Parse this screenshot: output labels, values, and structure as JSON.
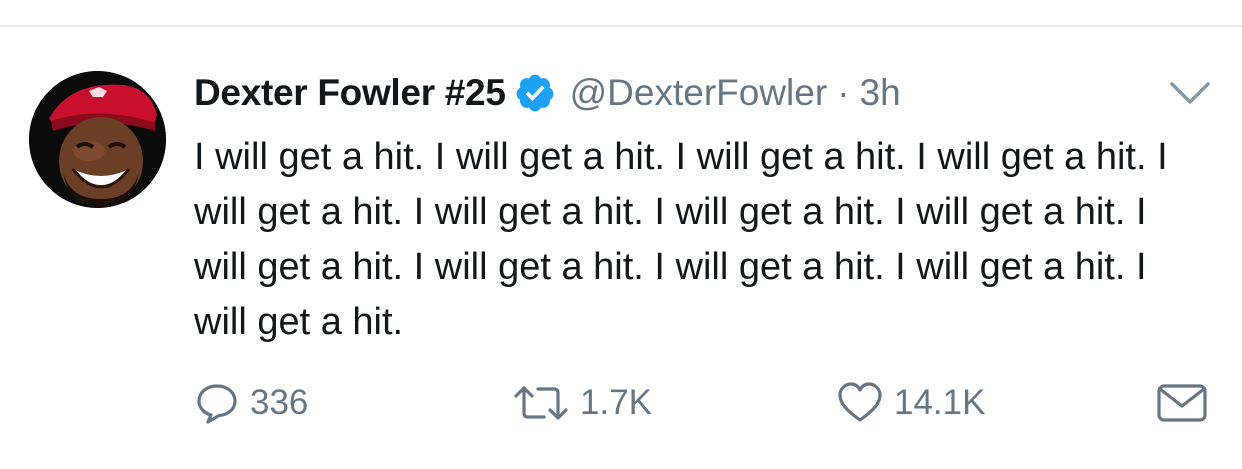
{
  "tweet": {
    "display_name": "Dexter Fowler #25",
    "handle": "@DexterFowler",
    "separator": "·",
    "time": "3h",
    "verified": true,
    "text": "I will get a hit. I will get a hit. I will get a hit. I will get a hit. I will get a hit. I will get a hit. I will get a hit. I will get a hit. I will get a hit. I will get a hit. I will get a hit. I will get a hit. I will get a hit."
  },
  "actions": {
    "reply_count": "336",
    "retweet_count": "1.7K",
    "like_count": "14.1K"
  },
  "icons": {
    "verified": "verified-badge-icon",
    "menu": "chevron-down-icon",
    "reply": "speech-bubble-icon",
    "retweet": "retweet-arrows-icon",
    "like": "heart-icon",
    "share": "envelope-icon"
  },
  "colors": {
    "text": "#14171a",
    "secondary": "#657786",
    "verified": "#1da1f2",
    "divider": "#e6ecf0"
  }
}
